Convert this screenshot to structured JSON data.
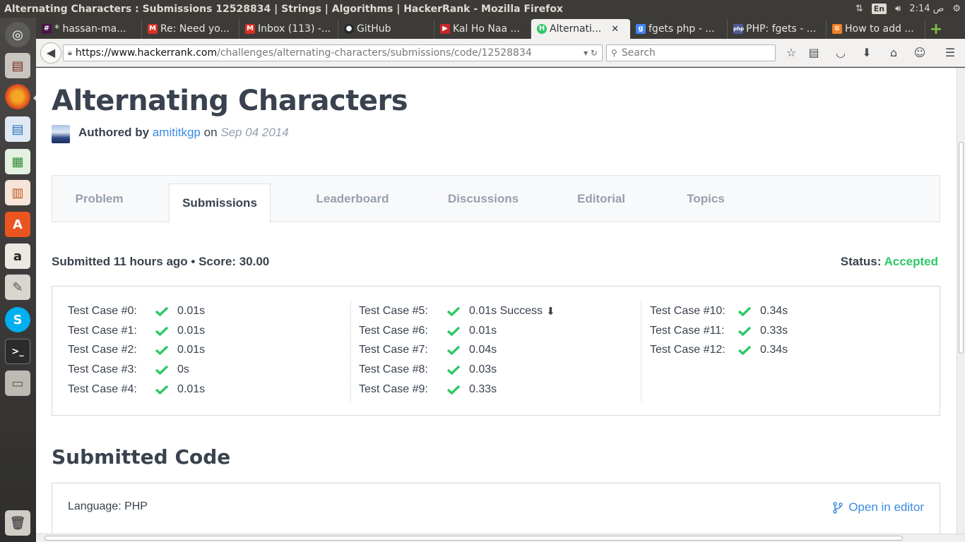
{
  "window": {
    "title": "Alternating Characters : Submissions 12528834 | Strings | Algorithms | HackerRank - Mozilla Firefox",
    "keyboard_layout": "En",
    "clock": "2:14 ص"
  },
  "browser": {
    "tabs": [
      {
        "label": "* hassan-ma...",
        "favicon": "slack-hash-icon",
        "color": "#4a154b"
      },
      {
        "label": "Re: Need yo...",
        "favicon": "gmail-icon",
        "color": "#d93025"
      },
      {
        "label": "Inbox (113) -...",
        "favicon": "gmail-icon",
        "color": "#d93025"
      },
      {
        "label": "GitHub",
        "favicon": "github-icon",
        "color": "#24292e"
      },
      {
        "label": "Kal Ho Naa ...",
        "favicon": "bookmark-icon",
        "color": "#c62828"
      },
      {
        "label": "Alternati...",
        "favicon": "hackerrank-icon",
        "color": "#2ec866",
        "active": true
      },
      {
        "label": "fgets php - ...",
        "favicon": "google-icon",
        "color": "#4285f4"
      },
      {
        "label": "PHP: fgets - ...",
        "favicon": "php-icon",
        "color": "#4f5b93"
      },
      {
        "label": "How to add ...",
        "favicon": "stackoverflow-icon",
        "color": "#f48024"
      }
    ],
    "url_host": "https://www.hackerrank.com",
    "url_path": "/challenges/alternating-characters/submissions/code/12528834",
    "search_placeholder": "Search"
  },
  "page": {
    "title": "Alternating Characters",
    "authored_by_label": "Authored by",
    "author": "amititkgp",
    "on_label": "on",
    "date": "Sep 04 2014",
    "tabs": [
      "Problem",
      "Submissions",
      "Leaderboard",
      "Discussions",
      "Editorial",
      "Topics"
    ],
    "active_tab": "Submissions",
    "submitted_text": "Submitted 11 hours ago • Score: 30.00",
    "status_label": "Status:",
    "status_value": "Accepted",
    "test_cases": [
      {
        "label": "Test Case #0:",
        "time": "0.01s"
      },
      {
        "label": "Test Case #1:",
        "time": "0.01s"
      },
      {
        "label": "Test Case #2:",
        "time": "0.01s"
      },
      {
        "label": "Test Case #3:",
        "time": "0s"
      },
      {
        "label": "Test Case #4:",
        "time": "0.01s"
      },
      {
        "label": "Test Case #5:",
        "time": "0.01s Success",
        "download": true
      },
      {
        "label": "Test Case #6:",
        "time": "0.01s"
      },
      {
        "label": "Test Case #7:",
        "time": "0.04s"
      },
      {
        "label": "Test Case #8:",
        "time": "0.03s"
      },
      {
        "label": "Test Case #9:",
        "time": "0.33s"
      },
      {
        "label": "Test Case #10:",
        "time": "0.34s"
      },
      {
        "label": "Test Case #11:",
        "time": "0.33s"
      },
      {
        "label": "Test Case #12:",
        "time": "0.34s"
      }
    ],
    "code_section_title": "Submitted Code",
    "language": "Language: PHP",
    "open_in_editor": "Open in editor",
    "colors": {
      "accent": "#3b8ce3",
      "success": "#2ec866",
      "text": "#39424e",
      "muted": "#979faf"
    }
  }
}
